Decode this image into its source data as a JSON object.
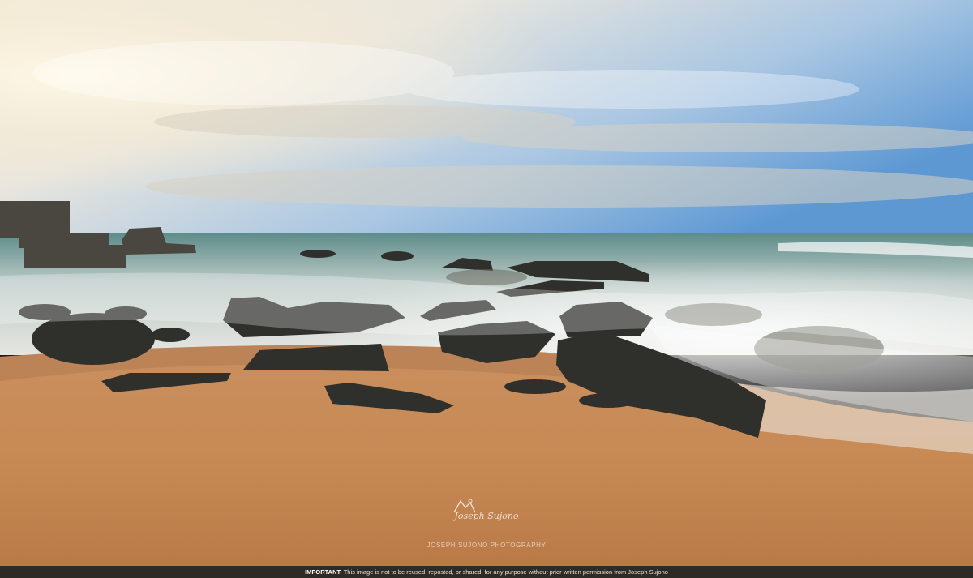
{
  "watermark": {
    "signature": "Joseph Sujono",
    "line": "JOSEPH SUJONO PHOTOGRAPHY"
  },
  "notice": {
    "label": "IMPORTANT:",
    "text": "This image is not to be reused, reposted, or shared, for any purpose without prior written permission from Joseph Sujono"
  }
}
